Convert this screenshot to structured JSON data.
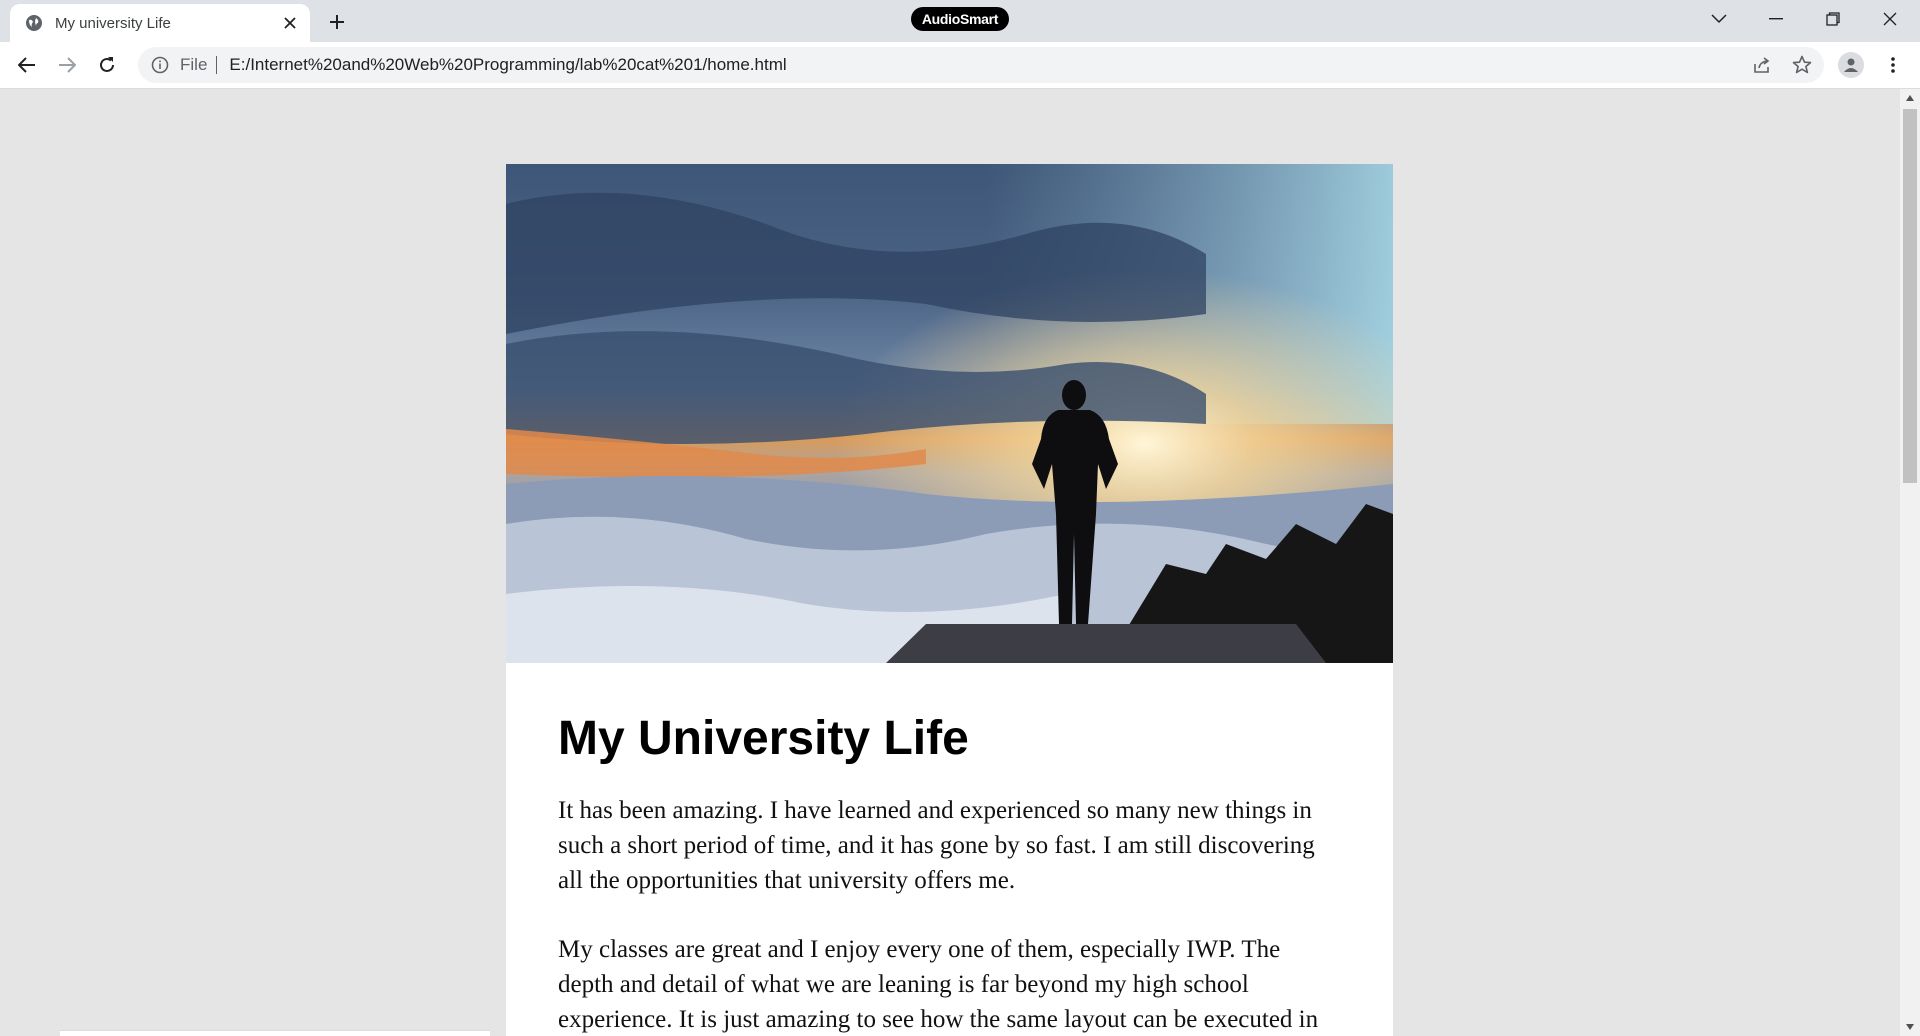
{
  "browser": {
    "tab": {
      "title": "My university Life",
      "favicon": "globe-icon"
    },
    "extension_badge": "AudioSmart",
    "omnibox": {
      "scheme_label": "File",
      "url": "E:/Internet%20and%20Web%20Programming/lab%20cat%201/home.html"
    },
    "icons": {
      "back": "back-arrow-icon",
      "forward": "forward-arrow-icon",
      "reload": "reload-icon",
      "info": "info-icon",
      "share": "share-icon",
      "bookmark": "star-icon",
      "profile": "profile-icon",
      "menu": "kebab-menu-icon",
      "tab_search": "chevron-down-icon",
      "minimize": "minimize-icon",
      "restore": "restore-icon",
      "close": "close-icon"
    }
  },
  "page": {
    "heading": "My University Life",
    "paragraphs": [
      "It has been amazing. I have learned and experienced so many new things in such a short period of time, and it has gone by so fast. I am still discovering all the opportunities that university offers me.",
      "My classes are great and I enjoy every one of them, especially IWP. The depth and detail of what we are leaning is far beyond my high school experience. It is just amazing to see how the same layout can be executed in"
    ]
  },
  "colors": {
    "page_background": "#e5e5e5",
    "card_background": "#ffffff",
    "tabstrip_background": "#dee1e6",
    "omnibox_background": "#f1f3f4"
  }
}
